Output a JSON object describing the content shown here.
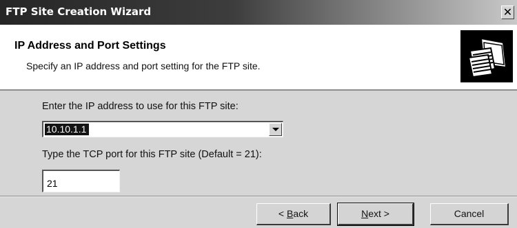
{
  "window": {
    "title": "FTP Site Creation Wizard",
    "close_glyph": "✕"
  },
  "header": {
    "title": "IP Address and Port Settings",
    "subtitle": "Specify an IP address and port setting for the FTP site.",
    "icon": "wizard-documents-icon"
  },
  "form": {
    "ip_label": "Enter the IP address to use for this FTP site:",
    "ip_value": "10.10.1.1",
    "port_label": "Type the TCP port for this FTP site (Default = 21):",
    "port_value": "21"
  },
  "buttons": {
    "back": {
      "prefix": "< ",
      "mnemonic": "B",
      "rest": "ack"
    },
    "next": {
      "mnemonic": "N",
      "rest": "ext >"
    },
    "cancel": "Cancel"
  },
  "colors": {
    "dialog_bg": "#d6d6d6",
    "titlebar_dark": "#262626",
    "selection": "#141414"
  }
}
